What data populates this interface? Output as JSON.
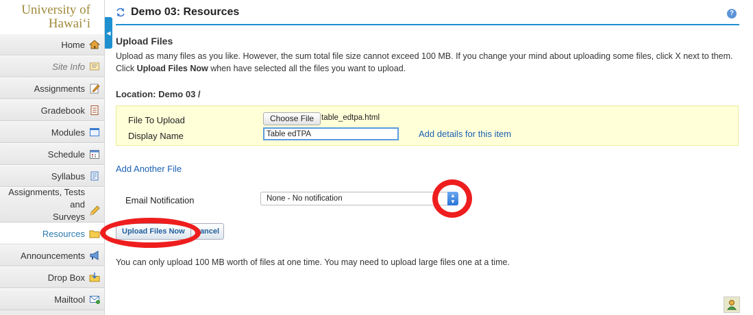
{
  "logo": {
    "line1": "University of",
    "line2": "Hawaiʻi"
  },
  "sidebar": {
    "items": [
      {
        "label": "Home",
        "icon": "home-icon"
      },
      {
        "label": "Site Info",
        "icon": "site-info-icon"
      },
      {
        "label": "Assignments",
        "icon": "assignments-icon"
      },
      {
        "label": "Gradebook",
        "icon": "gradebook-icon"
      },
      {
        "label": "Modules",
        "icon": "modules-icon"
      },
      {
        "label": "Schedule",
        "icon": "schedule-icon"
      },
      {
        "label": "Syllabus",
        "icon": "syllabus-icon"
      },
      {
        "label_line1": "Assignments, Tests and",
        "label_line2": "Surveys",
        "icon": "pencil-icon"
      },
      {
        "label": "Resources",
        "icon": "folder-icon"
      },
      {
        "label": "Announcements",
        "icon": "megaphone-icon"
      },
      {
        "label": "Drop Box",
        "icon": "dropbox-icon"
      },
      {
        "label": "Mailtool",
        "icon": "mail-icon"
      }
    ]
  },
  "header": {
    "title": "Demo 03: Resources",
    "help": "?"
  },
  "upload": {
    "section_title": "Upload Files",
    "desc_part1": "Upload as many files as you like. However, the sum total file size cannot exceed 100 MB. If you change your mind about uploading some files, click X next to them. Click ",
    "desc_bold": "Upload Files Now",
    "desc_part2": " when have selected all the files you want to upload.",
    "location": "Location: Demo 03 /",
    "file_to_upload_label": "File To Upload",
    "choose_file_label": "Choose File",
    "file_name": "table_edtpa.html",
    "display_name_label": "Display Name",
    "display_name_value": "Table edTPA",
    "details_link": "Add details for this item",
    "add_another": "Add Another File",
    "email_label": "Email Notification",
    "email_selected": "None - No notification",
    "upload_button": "Upload Files Now",
    "cancel_button": "Cancel",
    "footer_note": "You can only upload 100 MB worth of files at one time. You may need to upload large files one at a time."
  },
  "colors": {
    "accent": "#1e90d0",
    "annotation": "#ee1e1e",
    "link": "#1a5fb4",
    "logo": "#a08a3a"
  }
}
